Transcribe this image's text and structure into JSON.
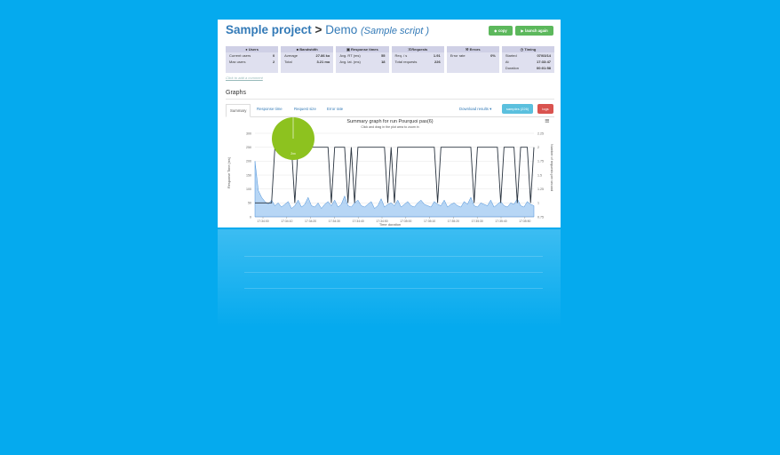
{
  "header": {
    "project": "Sample project",
    "separator": ">",
    "demo": "Demo",
    "script": "(Sample script )",
    "copy_label": "copy",
    "launch_label": "launch again"
  },
  "stats": {
    "users": {
      "title": "Users",
      "rows": [
        {
          "k": "Current users",
          "v": "0"
        },
        {
          "k": "Max users",
          "v": "2"
        }
      ]
    },
    "bandwidth": {
      "title": "Bandwidth",
      "rows": [
        {
          "k": "Average",
          "v": "27.86 ko"
        },
        {
          "k": "Total",
          "v": "3.21 mo"
        }
      ]
    },
    "response": {
      "title": "Response times",
      "rows": [
        {
          "k": "Avg. RT (ms)",
          "v": "55"
        },
        {
          "k": "Avg. lat. (ms)",
          "v": "18"
        }
      ]
    },
    "requests": {
      "title": "Requests",
      "rows": [
        {
          "k": "Req. / s",
          "v": "1.91"
        },
        {
          "k": "Total requests",
          "v": "226"
        }
      ]
    },
    "errors": {
      "title": "Errors",
      "rows": [
        {
          "k": "Error rate",
          "v": "0%"
        }
      ]
    },
    "timing": {
      "title": "Timing",
      "rows": [
        {
          "k": "Started",
          "v": "07/03/14"
        },
        {
          "k": "At",
          "v": "17:33:47"
        },
        {
          "k": "Duration",
          "v": "00:01:58"
        }
      ]
    }
  },
  "comment_link": "Click to add a comment",
  "graphs": {
    "heading": "Graphs",
    "tabs": [
      "Summary",
      "Response time",
      "Request size",
      "Error rate"
    ],
    "download": "Download results ▾",
    "samples_btn": "samples (226)",
    "logs_btn": "logs",
    "menu_icon": "≡"
  },
  "colors": {
    "green": "#5cb85c",
    "info": "#5bc0de",
    "danger": "#d9534f",
    "link": "#337ab7",
    "pie": "#8dc21f",
    "area": "#7cb5ec",
    "line": "#2a3440"
  },
  "chart_data": {
    "type": "area",
    "title": "Summary graph for run Pourquoi pas(6)",
    "subtitle": "Click and drag in the plot area to zoom in",
    "xlabel": "Time duration",
    "ylabel_left": "Response Time (ms)",
    "ylabel_right": "Number of requests per second",
    "x_ticks": [
      "17:34:00",
      "17:34:10",
      "17:34:20",
      "17:34:30",
      "17:34:40",
      "17:34:50",
      "17:35:00",
      "17:35:10",
      "17:35:20",
      "17:35:30",
      "17:35:40",
      "17:35:50"
    ],
    "y_left_ticks": [
      "0",
      "50",
      "100",
      "150",
      "200",
      "250",
      "300"
    ],
    "y_right_ticks": [
      "0.75",
      "1",
      "1.25",
      "1.5",
      "1.75",
      "2",
      "2.25"
    ],
    "ylim_left": [
      0,
      300
    ],
    "ylim_right": [
      0.75,
      2.25
    ],
    "pie": {
      "label": "2xx",
      "value": 100
    },
    "series": [
      {
        "name": "Response time",
        "axis": "left",
        "values": [
          200,
          95,
          70,
          55,
          45,
          60,
          40,
          50,
          35,
          45,
          55,
          30,
          40,
          60,
          35,
          45,
          70,
          40,
          35,
          50,
          30,
          45,
          55,
          40,
          60,
          35,
          45,
          75,
          40,
          35,
          50,
          60,
          40,
          35,
          45,
          55,
          30,
          40,
          65,
          35,
          45,
          50,
          40,
          60,
          35,
          45,
          55,
          40,
          35,
          50,
          60,
          45,
          40,
          35,
          55,
          45,
          40,
          60,
          35,
          45,
          50,
          40,
          35,
          55,
          45,
          70,
          40,
          35,
          50,
          45,
          40,
          60,
          35,
          45,
          55,
          40,
          35,
          50,
          45,
          65,
          40,
          35,
          55,
          45,
          40
        ]
      },
      {
        "name": "Requests per second",
        "axis": "right",
        "values": [
          1,
          1,
          1,
          1,
          1,
          1,
          2,
          2,
          2,
          2,
          2,
          2,
          1,
          2,
          2,
          2,
          2,
          2,
          2,
          2,
          2,
          2,
          2,
          1,
          2,
          2,
          2,
          2,
          1,
          2,
          1,
          2,
          2,
          2,
          2,
          2,
          2,
          2,
          2,
          2,
          1,
          2,
          1,
          2,
          2,
          2,
          2,
          2,
          2,
          2,
          2,
          2,
          2,
          2,
          2,
          1,
          2,
          2,
          2,
          2,
          2,
          2,
          2,
          2,
          2,
          2,
          1,
          2,
          2,
          2,
          2,
          2,
          2,
          2,
          1,
          2,
          2,
          2,
          2,
          1,
          2,
          2,
          2,
          1,
          2
        ]
      }
    ]
  }
}
